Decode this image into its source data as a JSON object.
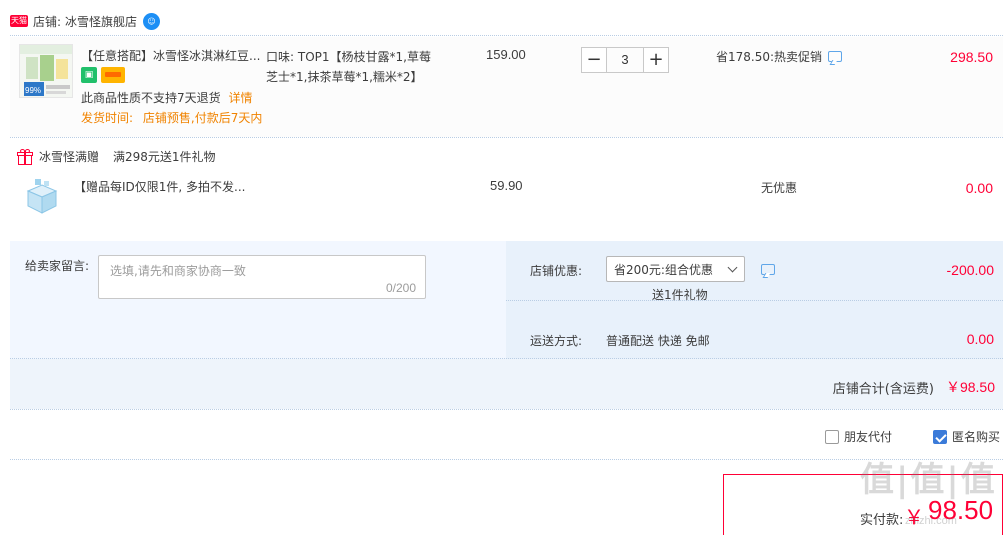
{
  "shop": {
    "badge": "天猫",
    "prefix": "店铺:",
    "name": "冰雪怪旗舰店"
  },
  "item": {
    "title": "【任意搭配】冰雪怪冰淇淋红豆...",
    "sku_line1": "口味:  TOP1【杨枝甘露*1,草莓",
    "sku_line2": "芝士*1,抹茶草莓*1,糯米*2】",
    "no_return": "此商品性质不支持7天退货",
    "details_link": "详情",
    "ship_label": "发货时间:",
    "ship_value": "店铺预售,付款后7天内",
    "unit_price": "159.00",
    "quantity": "3",
    "promo": "省178.50:热卖促销",
    "subtotal": "298.50"
  },
  "gift": {
    "label": "冰雪怪满赠",
    "rule": "满298元送1件礼物",
    "title": "【赠品每ID仅限1件, 多拍不发...",
    "price": "59.90",
    "promo": "无优惠",
    "subtotal": "0.00"
  },
  "order": {
    "memo_label": "给卖家留言:",
    "memo_placeholder": "选填,请先和商家协商一致",
    "memo_count": "0/200",
    "discount_label": "店铺优惠:",
    "discount_option": "省200元:组合优惠",
    "discount_note": "送1件礼物",
    "discount_amount": "-200.00",
    "shipping_label": "运送方式:",
    "shipping_value": "普通配送 快递 免邮",
    "shipping_amount": "0.00",
    "total_label": "店铺合计(含运费)",
    "total_value": "￥98.50"
  },
  "options": {
    "friend_pay": "朋友代付",
    "friend_pay_checked": false,
    "anonymous": "匿名购买",
    "anonymous_checked": true
  },
  "payment": {
    "label": "实付款:",
    "currency": "￥",
    "amount": "98.50"
  },
  "watermark": {
    "brand": "值|值|值",
    "url": "zhizhi.com"
  }
}
